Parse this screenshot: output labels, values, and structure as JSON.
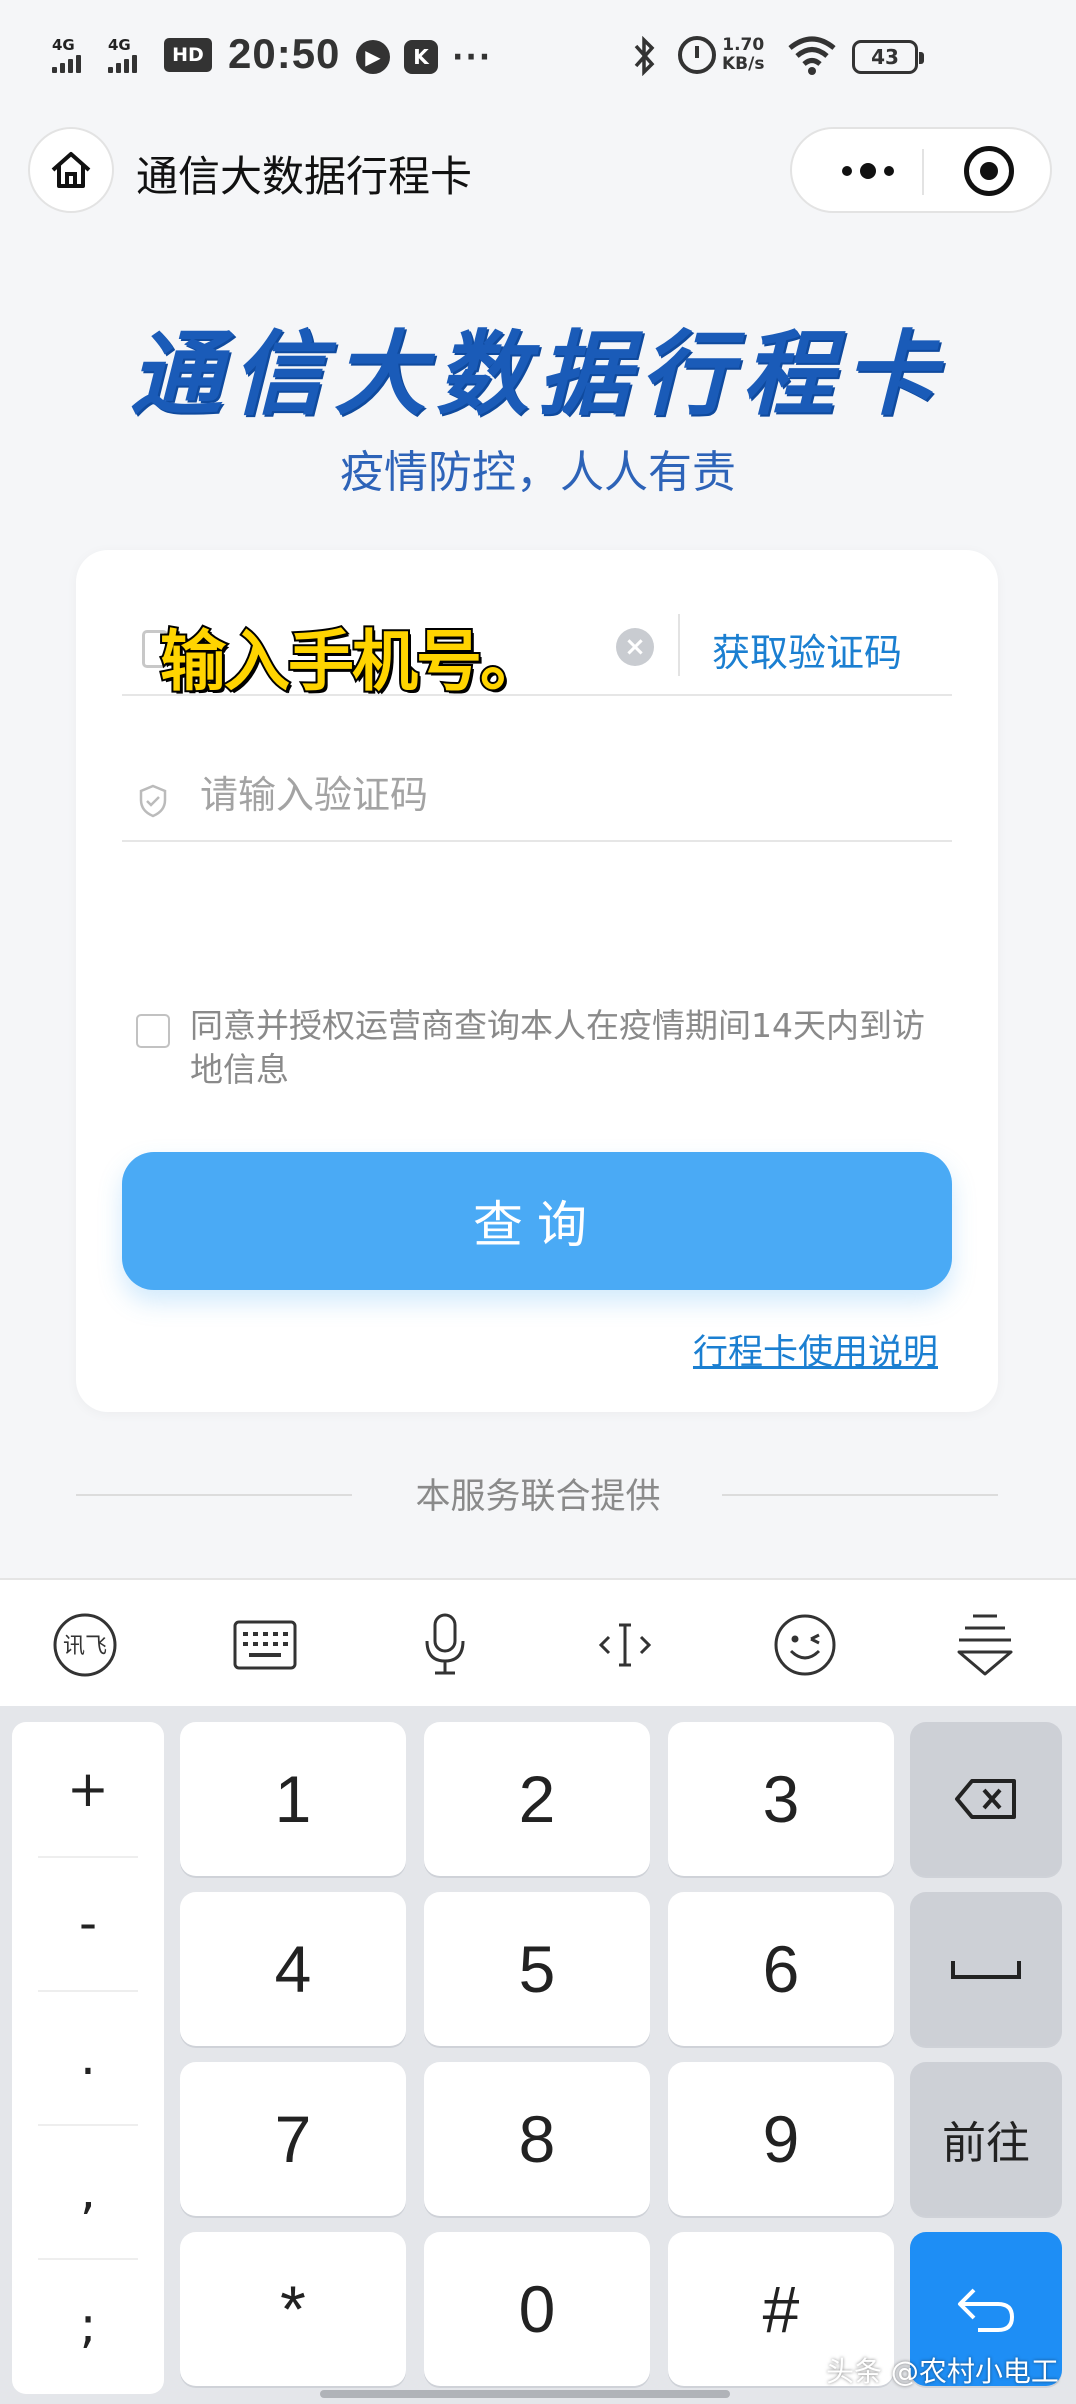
{
  "status_bar": {
    "signal1_label": "4G",
    "signal2_label": "4G",
    "hd_label": "HD",
    "time": "20:50",
    "app_icon_k": "K",
    "more_dots": "···",
    "net_speed_value": "1.70",
    "net_speed_unit": "KB/s",
    "battery": "43"
  },
  "navbar": {
    "title": "通信大数据行程卡"
  },
  "header": {
    "brand_title": "通信大数据行程卡",
    "slogan": "疫情防控，人人有责"
  },
  "form": {
    "phone_overlay_caption": "输入手机号。",
    "get_code_label": "获取验证码",
    "code_placeholder": "请输入验证码",
    "agreement_text": "同意并授权运营商查询本人在疫情期间14天内到访地信息",
    "query_button": "查询",
    "help_link": "行程卡使用说明"
  },
  "footer": {
    "text": "本服务联合提供"
  },
  "keyboard": {
    "toolbar_icons": [
      "ifly-logo-icon",
      "keyboard-icon",
      "microphone-icon",
      "cursor-icon",
      "emoji-icon",
      "hide-keyboard-icon"
    ],
    "ifly_label": "讯飞",
    "symbols": [
      "+",
      "-",
      ".",
      ",",
      ";"
    ],
    "digits": [
      "1",
      "2",
      "3",
      "4",
      "5",
      "6",
      "7",
      "8",
      "9",
      "*",
      "0",
      "#"
    ],
    "go_label": "前往"
  },
  "watermark": "头条 @农村小电工",
  "colors": {
    "brand_blue": "#1a5bb8",
    "link_blue": "#1b7fd1",
    "button_blue": "#4aaaf5",
    "enter_key_blue": "#1e8ef5"
  }
}
